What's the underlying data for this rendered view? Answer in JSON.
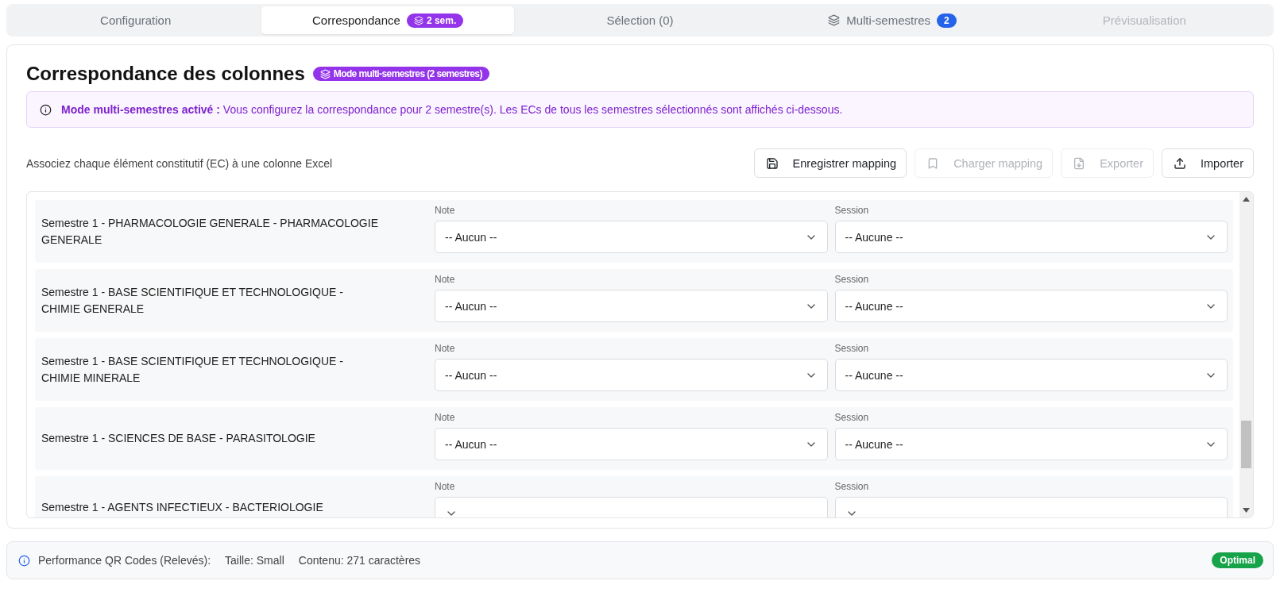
{
  "tabs": [
    {
      "label": "Configuration",
      "selected": false,
      "disabled": false
    },
    {
      "label": "Correspondance",
      "selected": true,
      "disabled": false,
      "badge": "2 sem.",
      "kind": "semesters"
    },
    {
      "label": "Sélection (0)",
      "selected": false,
      "disabled": false
    },
    {
      "label": "Multi-semestres",
      "selected": false,
      "disabled": false,
      "badge": "2",
      "kind": "multi"
    },
    {
      "label": "Prévisualisation",
      "selected": false,
      "disabled": true
    }
  ],
  "panel": {
    "title": "Correspondance des colonnes",
    "mode_badge": "Mode multi-semestres (2 semestres)",
    "notice": "**Mode multi-semestres activé :** Vous configurez la correspondance pour 2 semestre(s). Les ECs de tous les semestres sélectionnés sont affichés ci-dessous.",
    "instruction": "Associez chaque élément constitutif (EC) à une colonne Excel",
    "buttons": [
      {
        "label": "Enregistrer mapping",
        "disabled": false
      },
      {
        "label": "Charger mapping",
        "disabled": true
      },
      {
        "label": "Exporter",
        "disabled": true
      },
      {
        "label": "Importer",
        "disabled": false
      }
    ],
    "rows": [
      {
        "label": "Semestre 1 - PHARMACOLOGIE GENERALE - PHARMACOLOGIE GENERALE",
        "note_label": "Note",
        "note_value": "-- Aucun --",
        "session_label": "Session",
        "session_value": "-- Aucune --"
      },
      {
        "label": "Semestre 1 - BASE SCIENTIFIQUE ET TECHNOLOGIQUE - CHIMIE GENERALE",
        "note_label": "Note",
        "note_value": "-- Aucun --",
        "session_label": "Session",
        "session_value": "-- Aucune --"
      },
      {
        "label": "Semestre 1 - BASE SCIENTIFIQUE ET TECHNOLOGIQUE - CHIMIE MINERALE",
        "note_label": "Note",
        "note_value": "-- Aucun --",
        "session_label": "Session",
        "session_value": "-- Aucune --"
      },
      {
        "label": "Semestre 1 - SCIENCES DE BASE - PARASITOLOGIE",
        "note_label": "Note",
        "note_value": "-- Aucun --",
        "session_label": "Session",
        "session_value": "-- Aucune --"
      },
      {
        "label": "Semestre 1 - AGENTS INFECTIEUX - BACTERIOLOGIE",
        "note_label": "Note",
        "session_label": "Session"
      }
    ]
  },
  "footer": {
    "title": "Performance QR Codes (Relevés):",
    "size": "Taille: Small",
    "content": "Contenu: 271 caractères",
    "status": "Optimal"
  }
}
